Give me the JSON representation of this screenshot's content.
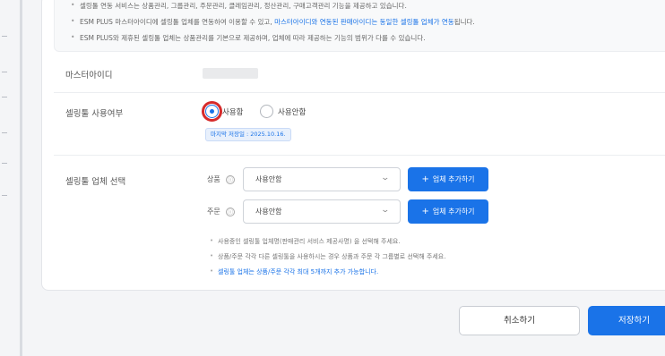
{
  "notice": {
    "line1": "셀링툴 연동 서비스는 상품관리, 그룹관리, 주문관리, 클레임관리, 정산관리, 구매고객관리 기능을 제공하고 있습니다.",
    "line2_a": "ESM PLUS 마스터아이디에 셀링툴 업체를 연동하여 이용할 수 있고, ",
    "line2_b": "마스터아이디와 연동된 판매아이디는 동일한 셀링툴 업체가 연동",
    "line2_c": "됩니다.",
    "line3": "ESM PLUS와 제휴된 셀링툴 업체는 상품관리를 기본으로 제공하며, 업체에 따라 제공하는 기능의 범위가 다를 수 있습니다."
  },
  "master_id": {
    "label": "마스터아이디"
  },
  "usage": {
    "label": "셀링툴 사용여부",
    "option_use": "사용함",
    "option_unused": "사용안함",
    "selected": "사용함",
    "last_saved": "마지막 저장일 : 2025.10.16."
  },
  "vendor": {
    "label": "셀링툴 업체 선택",
    "product_label": "상품",
    "order_label": "주문",
    "info_icon": "ⓘ",
    "product_value": "사용안함",
    "order_value": "사용안함",
    "add_button": "업체 추가하기",
    "hints": [
      "사용중인 셀링툴 업체명(판매관리 서비스 제공사명) 을 선택해 주세요.",
      "상품/주문 각각 다른 셀링툴을 사용하시는 경우 상품과 주문 각 그룹별로 선택해 주세요.",
      "셀링툴 업체는 상품/주문 각각 최대 5개까지 추가 가능합니다."
    ]
  },
  "footer": {
    "cancel": "취소하기",
    "save": "저장하기"
  },
  "colors": {
    "accent": "#1a73e8",
    "highlight_ring": "#d62b2b"
  }
}
